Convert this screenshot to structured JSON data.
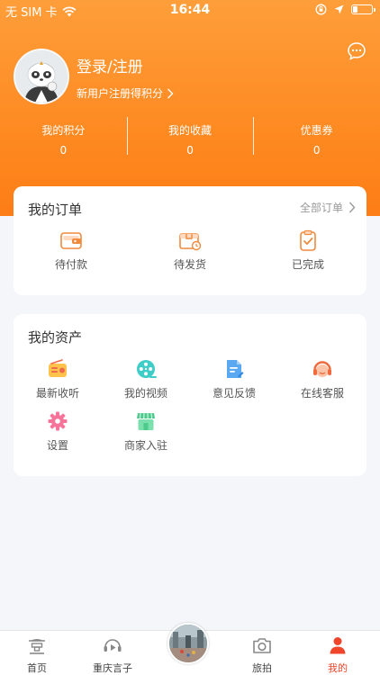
{
  "status": {
    "carrier": "无 SIM 卡",
    "time": "16:44"
  },
  "profile": {
    "login_label": "登录/注册",
    "register_hint": "新用户注册得积分"
  },
  "stats": [
    {
      "label": "我的积分",
      "value": "0"
    },
    {
      "label": "我的收藏",
      "value": "0"
    },
    {
      "label": "优惠券",
      "value": "0"
    }
  ],
  "orders": {
    "title": "我的订单",
    "all_label": "全部订单",
    "items": [
      {
        "label": "待付款",
        "icon": "wallet-icon"
      },
      {
        "label": "待发货",
        "icon": "package-icon"
      },
      {
        "label": "已完成",
        "icon": "clipboard-check-icon"
      }
    ]
  },
  "assets": {
    "title": "我的资产",
    "items": [
      {
        "label": "最新收听",
        "icon": "radio-icon"
      },
      {
        "label": "我的视频",
        "icon": "film-reel-icon"
      },
      {
        "label": "意见反馈",
        "icon": "feedback-doc-icon"
      },
      {
        "label": "在线客服",
        "icon": "headset-icon"
      },
      {
        "label": "设置",
        "icon": "settings-icon"
      },
      {
        "label": "商家入驻",
        "icon": "store-icon"
      }
    ]
  },
  "tabbar": [
    {
      "label": "首页",
      "icon": "home-pagoda-icon",
      "active": false
    },
    {
      "label": "重庆言子",
      "icon": "audio-play-icon",
      "active": false
    },
    {
      "label": "旅拍",
      "icon": "camera-icon",
      "active": false
    },
    {
      "label": "我的",
      "icon": "user-icon",
      "active": true
    }
  ],
  "colors": {
    "accent": "#fe8a22",
    "active_tab": "#f0452b",
    "background": "#f4f6f9"
  }
}
